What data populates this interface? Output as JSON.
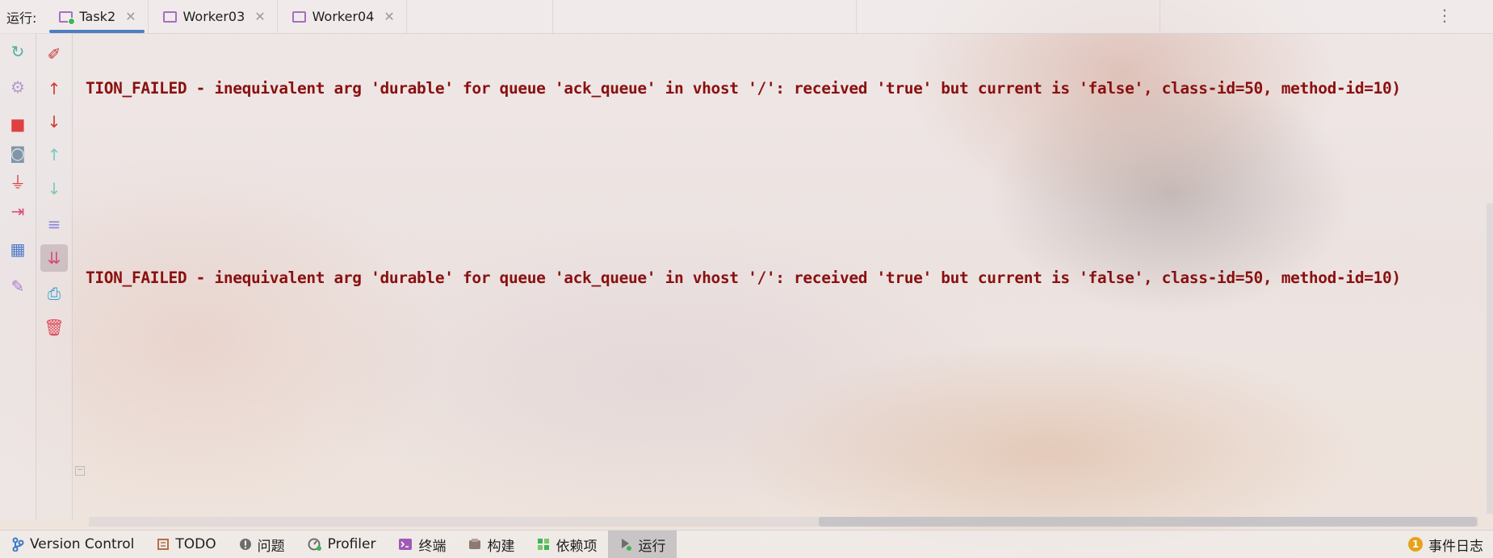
{
  "run_panel": {
    "label": "运行:",
    "tabs": [
      {
        "label": "Task2",
        "close": "✕"
      },
      {
        "label": "Worker03",
        "close": "✕"
      },
      {
        "label": "Worker04",
        "close": "✕"
      }
    ],
    "options_icon": "⋮"
  },
  "left_toolbar": [
    {
      "icon": "rerun-icon",
      "glyph": "↻",
      "color": "#4bb1a0"
    },
    {
      "icon": "settings-icon",
      "glyph": "⚙",
      "color": "#b59bcf"
    },
    {
      "icon": "stop-icon",
      "glyph": "■",
      "color": "#e0403f"
    },
    {
      "icon": "camera-icon",
      "glyph": "◙",
      "color": "#7f97a8"
    },
    {
      "icon": "plug-icon",
      "glyph": "⏚",
      "color": "#d94040"
    },
    {
      "icon": "exit-icon",
      "glyph": "⇥",
      "color": "#d94a7a"
    },
    {
      "icon": "layout-icon",
      "glyph": "▦",
      "color": "#4c7ac7"
    },
    {
      "icon": "pin-icon",
      "glyph": "✎",
      "color": "#a97ad1"
    }
  ],
  "side_toolbar": [
    {
      "icon": "clear-edit-icon",
      "glyph": "✐",
      "color": "#c23a3a"
    },
    {
      "icon": "up-arrow-icon",
      "glyph": "↑",
      "color": "#d23a2e"
    },
    {
      "icon": "down-arrow-icon",
      "glyph": "↓",
      "color": "#d23a2e"
    },
    {
      "icon": "up-arrow-light-icon",
      "glyph": "↑",
      "color": "#7cc9bd"
    },
    {
      "icon": "down-arrow-light-icon",
      "glyph": "↓",
      "color": "#7cc9bd"
    },
    {
      "icon": "soft-wrap-icon",
      "glyph": "≡",
      "color": "#8a8ad8"
    },
    {
      "icon": "scroll-to-end-icon",
      "glyph": "⇊",
      "color": "#d44c7a"
    },
    {
      "icon": "print-icon",
      "glyph": "⎙",
      "color": "#2ea0d6"
    },
    {
      "icon": "trash-icon",
      "glyph": "🗑",
      "color": "#e04a5a"
    }
  ],
  "console": {
    "lines": [
      "TION_FAILED - inequivalent arg 'durable' for queue 'ack_queue' in vhost '/': received 'true' but current is 'false', class-id=50, method-id=10)",
      "TION_FAILED - inequivalent arg 'durable' for queue 'ack_queue' in vhost '/': received 'true' but current is 'false', class-id=50, method-id=10)"
    ]
  },
  "status_bar": {
    "items": [
      {
        "label": "Version Control",
        "icon": "branch-icon"
      },
      {
        "label": "TODO",
        "icon": "todo-icon"
      },
      {
        "label": "问题",
        "icon": "problems-icon"
      },
      {
        "label": "Profiler",
        "icon": "profiler-icon"
      },
      {
        "label": "终端",
        "icon": "terminal-icon"
      },
      {
        "label": "构建",
        "icon": "build-icon"
      },
      {
        "label": "依赖项",
        "icon": "dependencies-icon"
      },
      {
        "label": "运行",
        "icon": "run-icon"
      }
    ],
    "event_log": {
      "label": "事件日志",
      "count": "1"
    }
  }
}
